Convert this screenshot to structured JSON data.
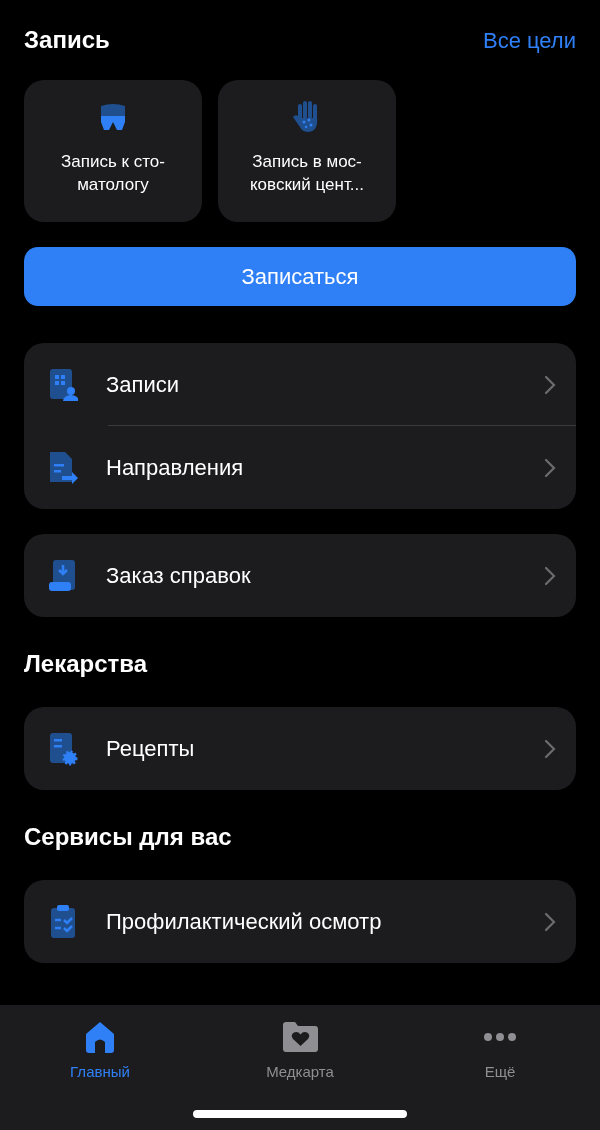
{
  "header": {
    "title": "Запись",
    "link": "Все цели"
  },
  "tiles": [
    {
      "kind": "tooth",
      "label": "Запись к сто-\nматологу"
    },
    {
      "kind": "hand",
      "label": "Запись в мос-\nковский цент..."
    }
  ],
  "primary_button": "Записаться",
  "groups": [
    [
      {
        "kind": "appointments",
        "label": "Записи"
      },
      {
        "kind": "referrals",
        "label": "Направления"
      }
    ],
    [
      {
        "kind": "certificates",
        "label": "Заказ справок"
      }
    ]
  ],
  "sections": [
    {
      "title": "Лекарства",
      "items": [
        {
          "kind": "prescriptions",
          "label": "Рецепты"
        }
      ]
    },
    {
      "title": "Сервисы для вас",
      "items": [
        {
          "kind": "checkup",
          "label": "Профилактический осмотр"
        }
      ]
    }
  ],
  "tab_bar": [
    {
      "kind": "home",
      "label": "Главный",
      "selected": true
    },
    {
      "kind": "medcard",
      "label": "Медкарта",
      "selected": false
    },
    {
      "kind": "more",
      "label": "Ещё",
      "selected": false
    }
  ]
}
